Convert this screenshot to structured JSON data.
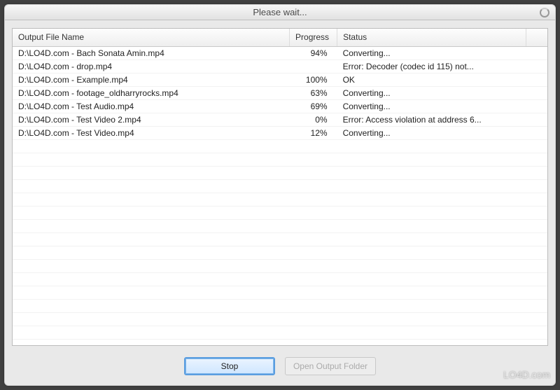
{
  "window": {
    "title": "Please wait..."
  },
  "table": {
    "headers": {
      "filename": "Output File Name",
      "progress": "Progress",
      "status": "Status"
    },
    "rows": [
      {
        "filename": "D:\\LO4D.com - Bach Sonata Amin.mp4",
        "progress": "94%",
        "status": "Converting..."
      },
      {
        "filename": "D:\\LO4D.com - drop.mp4",
        "progress": "",
        "status": "Error: Decoder (codec id 115) not..."
      },
      {
        "filename": "D:\\LO4D.com - Example.mp4",
        "progress": "100%",
        "status": "OK"
      },
      {
        "filename": "D:\\LO4D.com - footage_oldharryrocks.mp4",
        "progress": "63%",
        "status": "Converting..."
      },
      {
        "filename": "D:\\LO4D.com - Test Audio.mp4",
        "progress": "69%",
        "status": "Converting..."
      },
      {
        "filename": "D:\\LO4D.com - Test Video 2.mp4",
        "progress": "0%",
        "status": "Error: Access violation at address 6..."
      },
      {
        "filename": "D:\\LO4D.com - Test Video.mp4",
        "progress": "12%",
        "status": "Converting..."
      }
    ],
    "col_widths": {
      "filename": 395,
      "progress": 68,
      "status": 270,
      "pad": 30
    }
  },
  "buttons": {
    "stop": "Stop",
    "open_folder": "Open Output Folder"
  },
  "watermark": "LO4D.com"
}
